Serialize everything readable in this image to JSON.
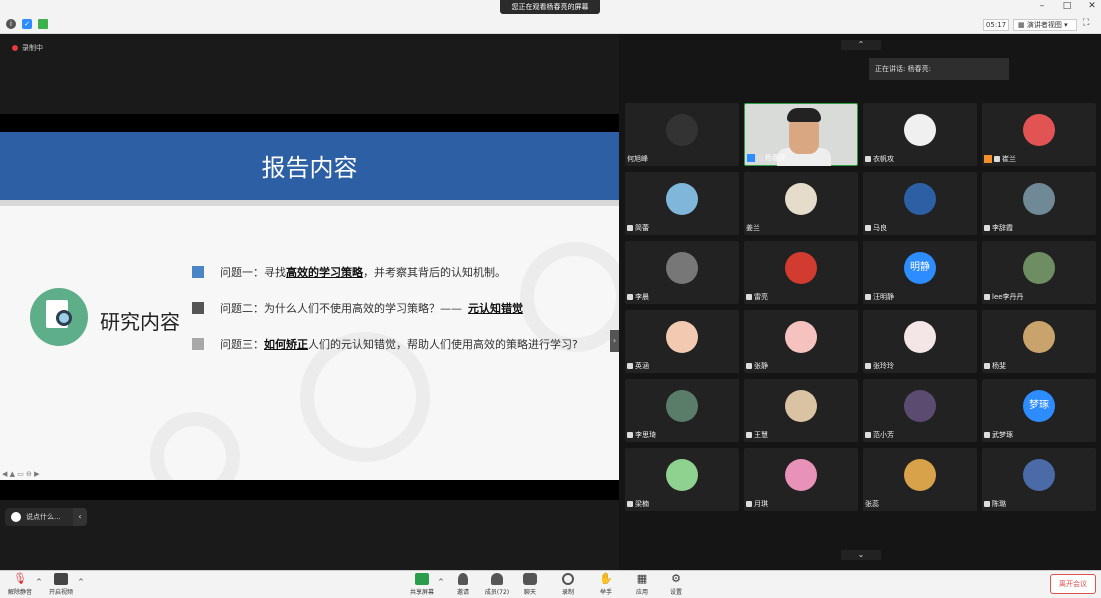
{
  "window": {
    "viewing_banner": "您正在观看杨春亮的屏幕",
    "minimize_icon": "minimize-icon",
    "restore_icon": "restore-icon",
    "close_icon": "close-icon"
  },
  "top_toolbar": {
    "time": "05:17",
    "view_mode": "演讲者视图",
    "fullscreen_icon": "fullscreen-icon"
  },
  "share": {
    "recording_label": "录制中",
    "slide": {
      "title": "报告内容",
      "section_label": "研究内容",
      "questions": [
        {
          "prefix": "问题一：寻找",
          "bold": "高效的学习策略",
          "suffix": "，并考察其背后的认知机制。",
          "color": "#4a86c5"
        },
        {
          "prefix": "问题二：为什么人们不使用高效的学习策略？——",
          "bold": "元认知错觉",
          "suffix": "",
          "color": "#555555"
        },
        {
          "prefix": "问题三：",
          "bold": "如何矫正",
          "suffix": "人们的元认知错觉，帮助人们使用高效的策略进行学习?",
          "color": "#a8a8a8"
        }
      ]
    },
    "chat_placeholder": "说点什么..."
  },
  "gallery": {
    "speaking_label": "正在讲话: 杨春亮:",
    "participants": [
      {
        "name": "何旭峰",
        "initial": "",
        "avatar_color": "#333333",
        "muted": false
      },
      {
        "name": "杨春亮",
        "initial": "",
        "avatar_color": "#d9a882",
        "muted": true,
        "active": true
      },
      {
        "name": "衣帆攻",
        "initial": "",
        "avatar_color": "#f0f0f0",
        "muted": true
      },
      {
        "name": "崔兰",
        "initial": "",
        "avatar_color": "#e25454",
        "muted": true
      },
      {
        "name": "简蕾",
        "initial": "",
        "avatar_color": "#7fb6d9",
        "muted": true
      },
      {
        "name": "姜兰",
        "initial": "",
        "avatar_color": "#e6dccb",
        "muted": false
      },
      {
        "name": "马良",
        "initial": "",
        "avatar_color": "#2c5fa4",
        "muted": true
      },
      {
        "name": "李辞霞",
        "initial": "",
        "avatar_color": "#6f8a96",
        "muted": true
      },
      {
        "name": "李晨",
        "initial": "",
        "avatar_color": "#777777",
        "muted": true
      },
      {
        "name": "雷亮",
        "initial": "",
        "avatar_color": "#d23b2f",
        "muted": true
      },
      {
        "name": "汪明静",
        "initial": "明静",
        "avatar_color": "#2d8cff",
        "muted": true
      },
      {
        "name": "lee李丹丹",
        "initial": "",
        "avatar_color": "#6e8d62",
        "muted": true
      },
      {
        "name": "英涵",
        "initial": "",
        "avatar_color": "#f2c9b1",
        "muted": true
      },
      {
        "name": "张静",
        "initial": "",
        "avatar_color": "#f5c2c0",
        "muted": true
      },
      {
        "name": "张玲玲",
        "initial": "",
        "avatar_color": "#f4e6e6",
        "muted": true
      },
      {
        "name": "杨斐",
        "initial": "",
        "avatar_color": "#c9a36c",
        "muted": true
      },
      {
        "name": "李思琦",
        "initial": "",
        "avatar_color": "#5a7d6a",
        "muted": true
      },
      {
        "name": "王慧",
        "initial": "",
        "avatar_color": "#d9c3a3",
        "muted": true
      },
      {
        "name": "范小芳",
        "initial": "",
        "avatar_color": "#5c4b70",
        "muted": true
      },
      {
        "name": "武梦琢",
        "initial": "梦琢",
        "avatar_color": "#2d8cff",
        "muted": true
      },
      {
        "name": "梁楠",
        "initial": "",
        "avatar_color": "#8fd18f",
        "muted": true
      },
      {
        "name": "月琪",
        "initial": "",
        "avatar_color": "#e892b9",
        "muted": true
      },
      {
        "name": "张蕊",
        "initial": "",
        "avatar_color": "#d8a24a",
        "muted": false
      },
      {
        "name": "陈璐",
        "initial": "",
        "avatar_color": "#4a6ba8",
        "muted": true
      }
    ]
  },
  "bottom_bar": {
    "unmute": "解除静音",
    "start_video": "开启视频",
    "share_screen": "共享屏幕",
    "invite": "邀请",
    "members": "成员(72)",
    "chat": "聊天",
    "record": "录制",
    "raise_hand": "举手",
    "apps": "应用",
    "settings": "设置",
    "leave": "离开会议"
  }
}
